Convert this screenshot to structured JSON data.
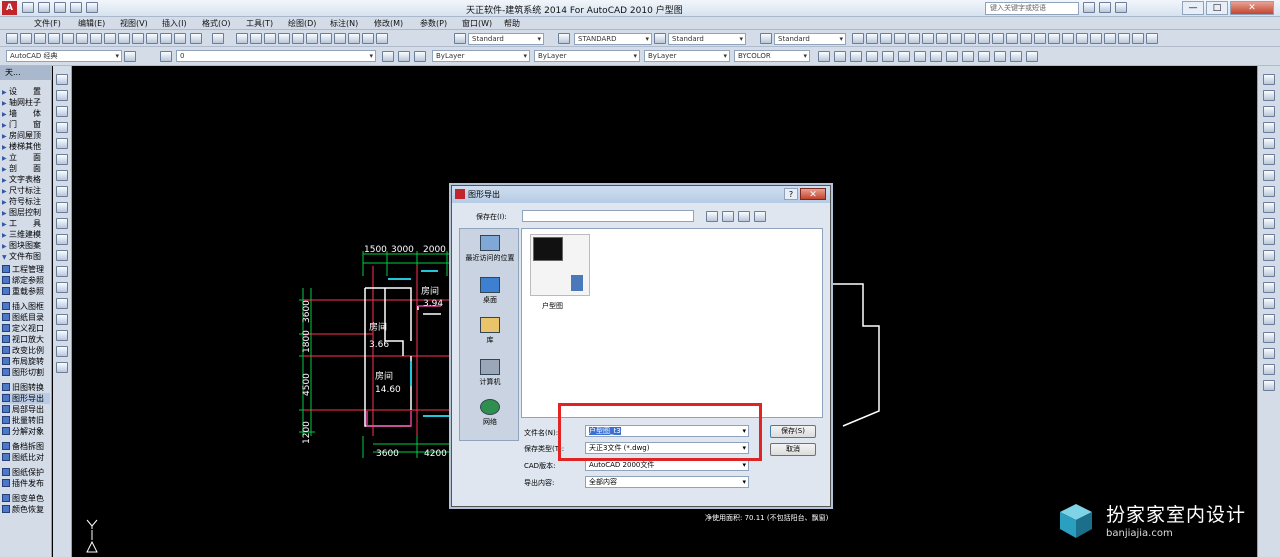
{
  "window": {
    "title": "天正软件-建筑系统 2014  For AutoCAD 2010      户型图",
    "search_placeholder": "键入关键字或短语",
    "min": "—",
    "max": "□",
    "close": "✕"
  },
  "menu": [
    "文件(F)",
    "编辑(E)",
    "视图(V)",
    "插入(I)",
    "格式(O)",
    "工具(T)",
    "绘图(D)",
    "标注(N)",
    "修改(M)",
    "参数(P)",
    "窗口(W)",
    "帮助"
  ],
  "toolbar": {
    "text_style": "Standard",
    "dim_style": "STANDARD",
    "table_style": "Standard",
    "mleader_style": "Standard",
    "workspace": "AutoCAD 经典",
    "layer": "0",
    "color": "ByLayer",
    "linetype": "ByLayer",
    "lineweight": "ByLayer",
    "plotstyle": "BYCOLOR"
  },
  "left_panel": {
    "title": "天...",
    "items": [
      "设　　置",
      "轴网柱子",
      "墙　　体",
      "门　　窗",
      "房间屋顶",
      "楼梯其他",
      "立　　面",
      "剖　　面",
      "文字表格",
      "尺寸标注",
      "符号标注",
      "图层控制",
      "工　　具",
      "三维建模",
      "图块图案",
      "文件布图"
    ],
    "subitems": [
      "工程管理",
      "绑定参照",
      "重载参照",
      "插入图框",
      "图纸目录",
      "定义视口",
      "视口放大",
      "改变比例",
      "布局旋转",
      "图形切割",
      "旧图转换",
      "图形导出",
      "局部导出",
      "批量转旧",
      "分解对象",
      "备档拆图",
      "图纸比对",
      "图纸保护",
      "插件发布",
      "图变单色",
      "颜色恢复"
    ]
  },
  "drawing": {
    "dims_top": [
      "1500",
      "3000",
      "2000"
    ],
    "dims_bottom": [
      "3600",
      "4200"
    ],
    "dims_left": [
      "3600",
      "1800",
      "4500",
      "1200"
    ],
    "rooms": [
      {
        "name": "房间",
        "area": "3.94"
      },
      {
        "name": "房间",
        "area": "3.66"
      },
      {
        "name": "房间",
        "area": "14.60"
      }
    ],
    "area_note": "净使用面积: 70.11 (不包括阳台、飘窗)"
  },
  "dialog": {
    "title": "图形导出",
    "help": "?",
    "close": "✕",
    "save_in_label": "保存在(I):",
    "places": [
      "最近访问的位置",
      "桌面",
      "库",
      "计算机",
      "网络"
    ],
    "file_item": "户型图",
    "filename_label": "文件名(N):",
    "filename_value": "户型图_t3",
    "filetype_label": "保存类型(T):",
    "filetype_value": "天正3文件 (*.dwg)",
    "cad_version_label": "CAD版本:",
    "cad_version_value": "AutoCAD 2000文件",
    "export_content_label": "导出内容:",
    "export_content_value": "全部内容",
    "save_button": "保存(S)",
    "cancel_button": "取消"
  },
  "watermark": {
    "text": "扮家家室内设计",
    "url": "banjiajia.com"
  },
  "colors": {
    "highlight": "#e02424",
    "wall": "#ffffff",
    "dimension": "#00cc44",
    "axis": "#ff3355",
    "window": "#22c5d9",
    "room_mark": "#e040a0"
  }
}
